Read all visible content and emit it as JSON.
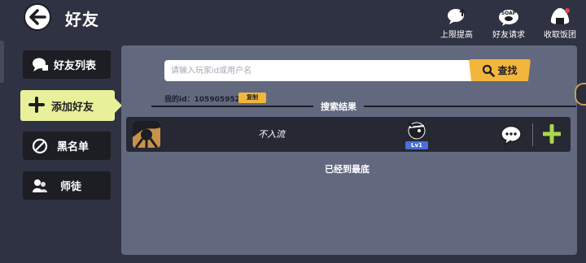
{
  "header": {
    "title": "好友",
    "buttons": [
      {
        "label": "上限提高",
        "icon": "chat-bubble-up-icon"
      },
      {
        "label": "好友请求",
        "icon": "soap-request-icon"
      },
      {
        "label": "收取饭团",
        "icon": "rice-ball-icon"
      }
    ]
  },
  "sidebar": {
    "items": [
      {
        "label": "好友列表",
        "icon": "chat-bubbles-icon",
        "active": false
      },
      {
        "label": "添加好友",
        "icon": "plus-icon",
        "active": true
      },
      {
        "label": "黑名单",
        "icon": "block-icon",
        "active": false
      },
      {
        "label": "师徒",
        "icon": "mentor-icon",
        "active": false
      }
    ]
  },
  "search": {
    "placeholder": "请输入玩家id或用户名",
    "button_label": "查找",
    "my_id_label": "我的id：",
    "my_id_value": "105905952",
    "copy_label": "复制"
  },
  "results": {
    "header": "搜索结果",
    "rows": [
      {
        "name": "不入流",
        "level": "Lv1"
      }
    ],
    "end_text": "已经到最底"
  },
  "colors": {
    "background": "#2f3242",
    "panel": "#62697f",
    "accent_yellow": "#f2b63d",
    "active_tab": "#e8f09a",
    "add_green": "#a8d84a",
    "level_badge": "#4a6fd8"
  }
}
